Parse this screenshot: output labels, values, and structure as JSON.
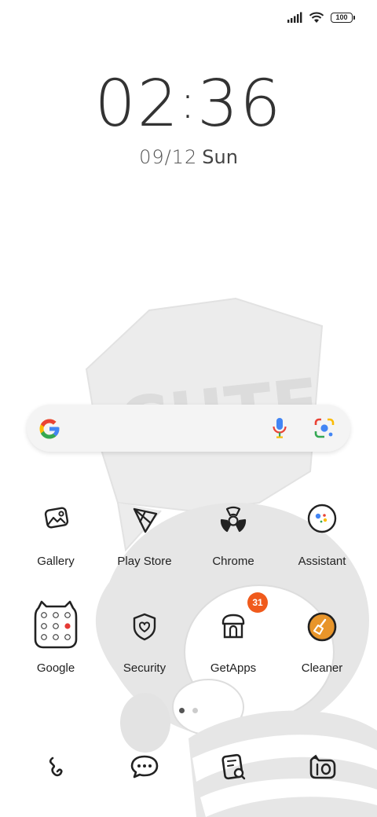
{
  "status_bar": {
    "signal_icon": "signal-bars-icon",
    "wifi_icon": "wifi-icon",
    "battery_level": "100"
  },
  "lockclock": {
    "hours": "02",
    "minutes": "36",
    "date": "09/12",
    "day": "Sun"
  },
  "search_widget": {
    "logo_icon": "google-g-icon",
    "voice_icon": "microphone-icon",
    "lens_icon": "google-lens-icon"
  },
  "apps_row1": [
    {
      "label": "Gallery",
      "icon": "gallery-icon"
    },
    {
      "label": "Play Store",
      "icon": "play-store-icon"
    },
    {
      "label": "Chrome",
      "icon": "chrome-icon"
    },
    {
      "label": "Assistant",
      "icon": "assistant-icon"
    }
  ],
  "apps_row2": [
    {
      "label": "Google",
      "icon": "google-folder-icon"
    },
    {
      "label": "Security",
      "icon": "security-shield-icon"
    },
    {
      "label": "GetApps",
      "icon": "getapps-icon",
      "badge": "31"
    },
    {
      "label": "Cleaner",
      "icon": "cleaner-broom-icon"
    }
  ],
  "pager": {
    "pages": 2,
    "active": 1
  },
  "dock": [
    {
      "icon": "phone-icon"
    },
    {
      "icon": "messages-icon"
    },
    {
      "icon": "notes-icon"
    },
    {
      "icon": "camera-icon"
    }
  ],
  "colors": {
    "badge": "#f05a1c",
    "cleaner_accent": "#e8952a",
    "google_blue": "#4285F4",
    "google_red": "#EA4335",
    "google_yellow": "#FBBC05",
    "google_green": "#34A853"
  }
}
